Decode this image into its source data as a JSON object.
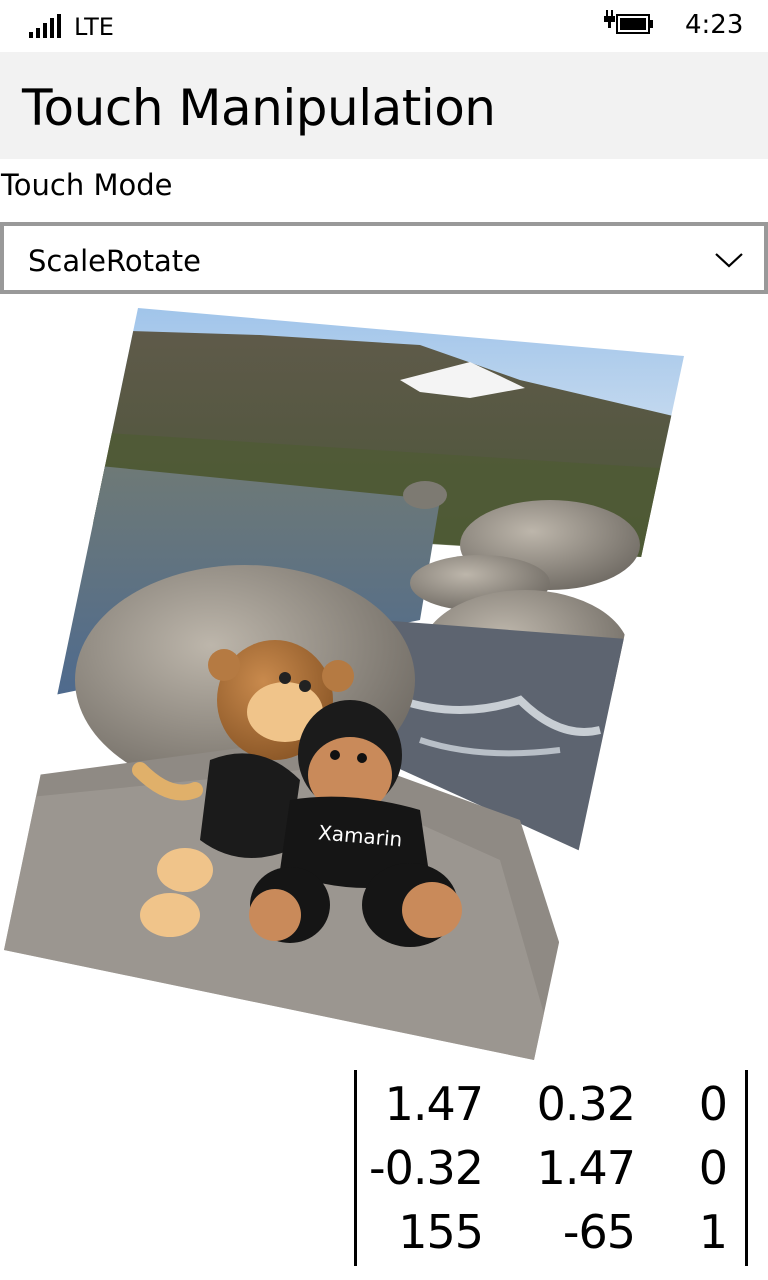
{
  "status_bar": {
    "network": "LTE",
    "time": "4:23",
    "icons": {
      "signal": "signal-strength-icon",
      "battery": "battery-charging-icon"
    }
  },
  "header": {
    "title": "Touch Manipulation"
  },
  "touch_mode": {
    "label": "Touch Mode",
    "selected": "ScaleRotate",
    "dropdown_icon": "chevron-down-icon"
  },
  "photo": {
    "description_icon": "photo-image",
    "shirt_text": "Xamarin"
  },
  "matrix": {
    "rows": [
      [
        "1.47",
        "0.32",
        "0"
      ],
      [
        "-0.32",
        "1.47",
        "0"
      ],
      [
        "155",
        "-65",
        "1"
      ]
    ]
  },
  "colors": {
    "title_bar_bg": "#f2f2f2",
    "combo_border": "#999999",
    "text": "#000000"
  }
}
